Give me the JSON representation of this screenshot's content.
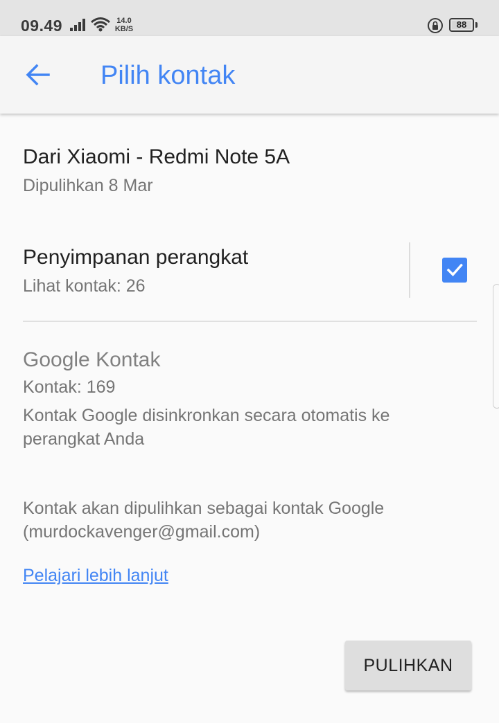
{
  "status_bar": {
    "time": "09.49",
    "net_speed_value": "14.0",
    "net_speed_unit": "KB/S",
    "battery": "88"
  },
  "app_bar": {
    "title": "Pilih kontak",
    "back_icon": "arrow-left-icon"
  },
  "source": {
    "title": "Dari Xiaomi - Redmi Note 5A",
    "subtitle": "Dipulihkan 8 Mar"
  },
  "device_storage": {
    "title": "Penyimpanan perangkat",
    "subtitle": "Lihat kontak: 26",
    "checked": true
  },
  "google_contacts": {
    "title": "Google Kontak",
    "count": "Kontak: 169",
    "description": "Kontak Google disinkronkan secara otomatis ke perangkat Anda"
  },
  "restore_note": "Kontak akan dipulihkan sebagai kontak Google (murdockavenger@gmail.com)",
  "learn_more_link": "Pelajari lebih lanjut",
  "restore_button": "PULIHKAN",
  "colors": {
    "accent": "#4285f4",
    "primary_text": "#212121",
    "secondary_text": "#757575"
  }
}
